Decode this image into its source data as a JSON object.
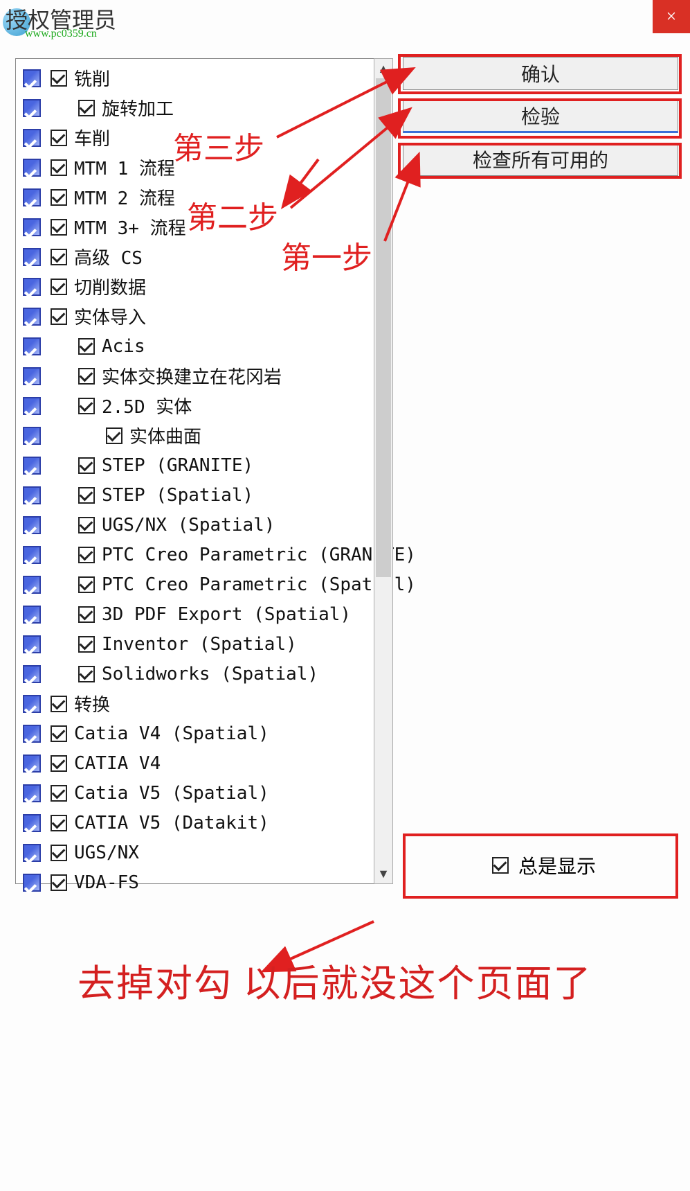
{
  "title": "授权管理员",
  "watermark_url": "www.pc0359.cn",
  "buttons": {
    "confirm": "确认",
    "verify": "检验",
    "check_all": "检查所有可用的",
    "close": "×"
  },
  "tree": [
    {
      "indent": 0,
      "label": "铣削"
    },
    {
      "indent": 1,
      "label": "旋转加工"
    },
    {
      "indent": 0,
      "label": "车削"
    },
    {
      "indent": 0,
      "label": "MTM 1 流程"
    },
    {
      "indent": 0,
      "label": "MTM 2 流程"
    },
    {
      "indent": 0,
      "label": "MTM 3+ 流程"
    },
    {
      "indent": 0,
      "label": "高级 CS"
    },
    {
      "indent": 0,
      "label": "切削数据"
    },
    {
      "indent": 0,
      "label": "实体导入"
    },
    {
      "indent": 1,
      "label": "Acis"
    },
    {
      "indent": 1,
      "label": "实体交换建立在花冈岩"
    },
    {
      "indent": 1,
      "label": "2.5D 实体"
    },
    {
      "indent": 2,
      "label": "实体曲面"
    },
    {
      "indent": 1,
      "label": "STEP (GRANITE)"
    },
    {
      "indent": 1,
      "label": "STEP (Spatial)"
    },
    {
      "indent": 1,
      "label": "UGS/NX (Spatial)"
    },
    {
      "indent": 1,
      "label": "PTC Creo Parametric (GRANITE)"
    },
    {
      "indent": 1,
      "label": "PTC Creo Parametric (Spatial)"
    },
    {
      "indent": 1,
      "label": "3D PDF Export (Spatial)"
    },
    {
      "indent": 1,
      "label": "Inventor (Spatial)"
    },
    {
      "indent": 1,
      "label": "Solidworks (Spatial)"
    },
    {
      "indent": 0,
      "label": "转换"
    },
    {
      "indent": 0,
      "label": "Catia V4 (Spatial)"
    },
    {
      "indent": 0,
      "label": "CATIA V4"
    },
    {
      "indent": 0,
      "label": "Catia V5 (Spatial)"
    },
    {
      "indent": 0,
      "label": "CATIA V5 (Datakit)"
    },
    {
      "indent": 0,
      "label": "UGS/NX"
    },
    {
      "indent": 0,
      "label": "VDA-FS"
    }
  ],
  "annotations": {
    "step3": "第三步",
    "step2": "第二步",
    "step1": "第一步"
  },
  "always_show": "总是显示",
  "bottom_note": "去掉对勾 以后就没这个页面了"
}
